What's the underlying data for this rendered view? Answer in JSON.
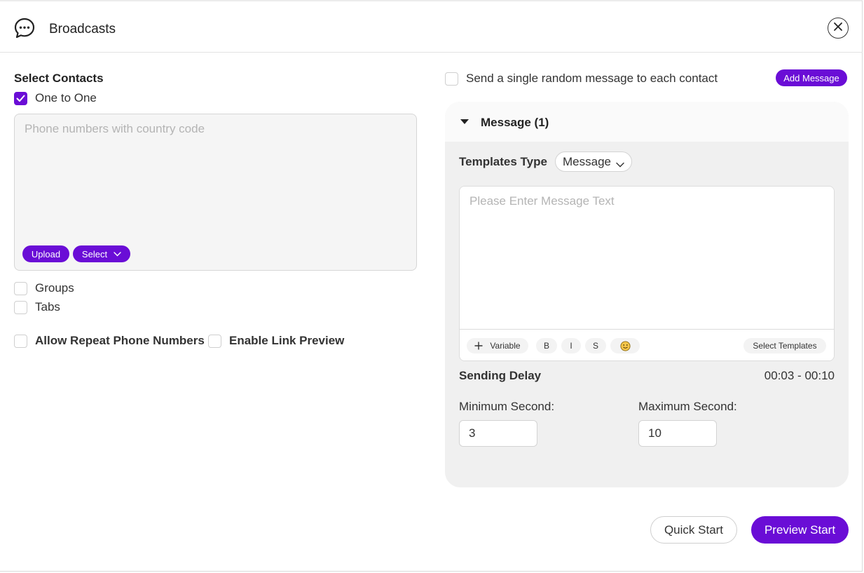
{
  "header": {
    "title": "Broadcasts",
    "app_icon": "chat-bubble-dots-icon",
    "close_icon": "close-icon"
  },
  "contacts": {
    "title": "Select Contacts",
    "one_to_one": {
      "label": "One to One",
      "checked": true
    },
    "phone_input": {
      "value": "",
      "placeholder": "Phone numbers with country code"
    },
    "upload_label": "Upload",
    "select_label": "Select",
    "groups": {
      "label": "Groups",
      "checked": false
    },
    "tabs": {
      "label": "Tabs",
      "checked": false
    }
  },
  "options": {
    "allow_repeat": {
      "label": "Allow Repeat Phone Numbers",
      "checked": false
    },
    "link_preview": {
      "label": "Enable Link Preview",
      "checked": false
    }
  },
  "messages": {
    "random_single": {
      "label": "Send a single random message to each contact",
      "checked": false
    },
    "add_label": "Add Message",
    "panel_title": "Message (1)",
    "templates_type_label": "Templates Type",
    "templates_type_value": "Message",
    "editor": {
      "value": "",
      "placeholder": "Please Enter Message Text"
    },
    "toolbar": {
      "variable": "Variable",
      "bold": "B",
      "italic": "I",
      "strike": "S",
      "select_templates": "Select Templates"
    }
  },
  "delay": {
    "label": "Sending Delay",
    "range": "00:03 - 00:10",
    "min_label": "Minimum Second:",
    "min_value": "3",
    "max_label": "Maximum Second:",
    "max_value": "10"
  },
  "footer": {
    "quick_start": "Quick Start",
    "preview_start": "Preview Start"
  },
  "colors": {
    "accent": "#6a0dd6",
    "panel_bg": "#f0f0f0"
  }
}
